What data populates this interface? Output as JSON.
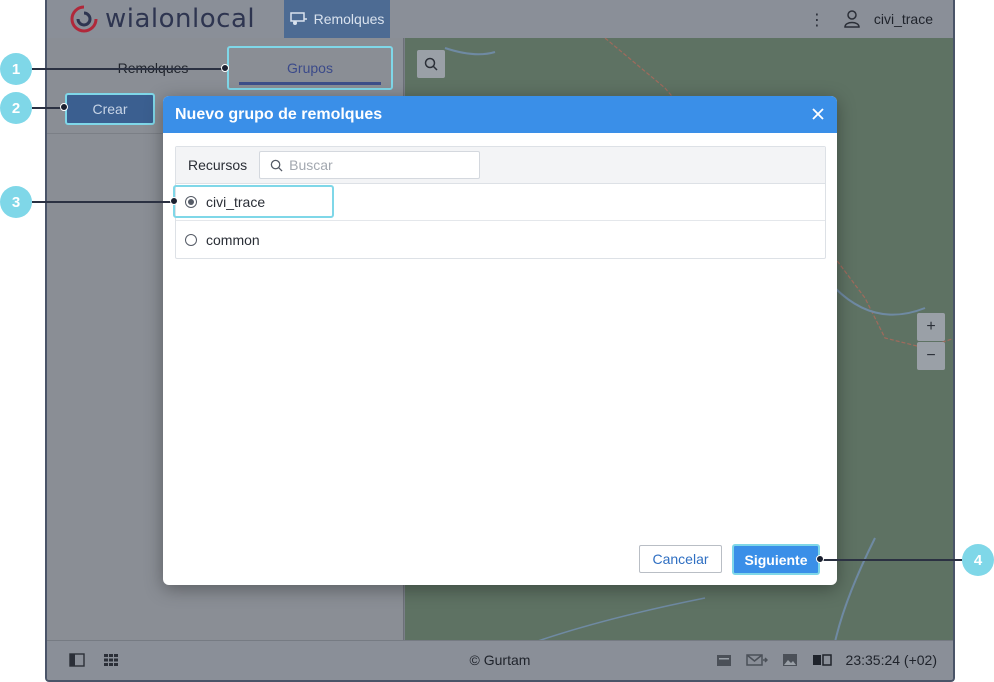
{
  "app": {
    "logo_text": "wialonlocal"
  },
  "topbar": {
    "nav_tab_label": "Remolques",
    "username": "civi_trace"
  },
  "left_panel": {
    "tabs": [
      {
        "label": "Remolques"
      },
      {
        "label": "Grupos"
      }
    ],
    "create_button": "Crear"
  },
  "map": {
    "zoom_in": "+",
    "zoom_out": "−"
  },
  "modal": {
    "title": "Nuevo grupo de remolques",
    "resources_label": "Recursos",
    "search_placeholder": "Buscar",
    "search_value": "",
    "resources": [
      {
        "name": "civi_trace",
        "selected": true
      },
      {
        "name": "common",
        "selected": false
      }
    ],
    "cancel_label": "Cancelar",
    "next_label": "Siguiente"
  },
  "footer": {
    "copyright": "© Gurtam",
    "clock": "23:35:24 (+02)"
  },
  "callouts": [
    "1",
    "2",
    "3",
    "4"
  ],
  "colors": {
    "accent": "#3a8fe8",
    "highlight": "#7fd7e8",
    "nav_tab": "#4d6b93"
  }
}
